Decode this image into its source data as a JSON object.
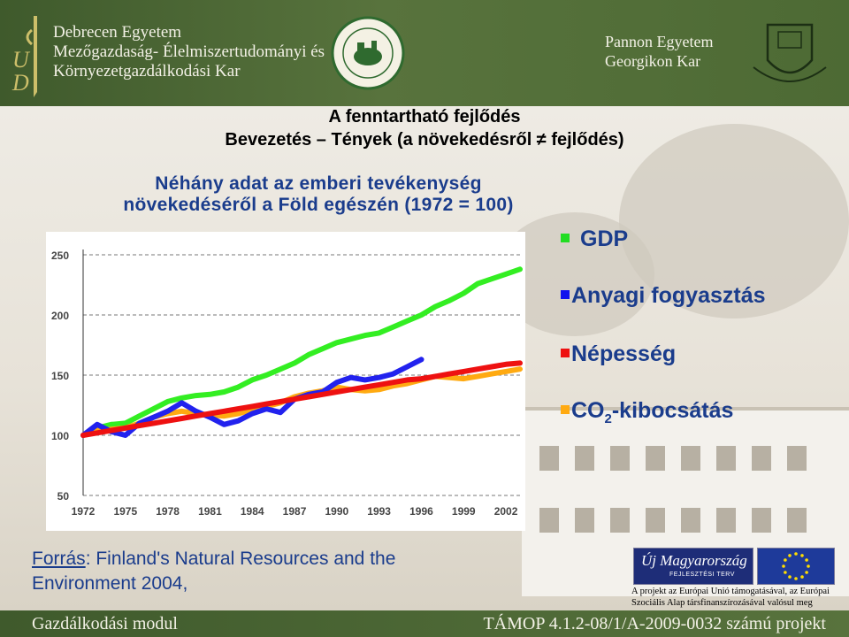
{
  "header": {
    "left_lines": [
      "Debrecen Egyetem",
      "Mezőgazdaság- Élelmiszertudományi és",
      "Környezetgazdálkodási Kar"
    ],
    "right_lines": [
      "Pannon Egyetem",
      "Georgikon Kar"
    ]
  },
  "slide": {
    "title": "A fenntartható fejlődés",
    "subtitle": "Bevezetés – Tények (a növekedésről ≠ fejlődés)",
    "chart_heading_lines": [
      "Néhány adat az emberi tevékenység",
      "növekedéséről a Föld egészén (1972 = 100)"
    ]
  },
  "chart_data": {
    "type": "line",
    "x": [
      1972,
      1973,
      1974,
      1975,
      1976,
      1977,
      1978,
      1979,
      1980,
      1981,
      1982,
      1983,
      1984,
      1985,
      1986,
      1987,
      1988,
      1989,
      1990,
      1991,
      1992,
      1993,
      1994,
      1995,
      1996,
      1997,
      1998,
      1999,
      2000,
      2001,
      2002,
      2003
    ],
    "xticks": [
      1972,
      1975,
      1978,
      1981,
      1984,
      1987,
      1990,
      1993,
      1996,
      1999,
      2002
    ],
    "yticks": [
      50,
      100,
      150,
      200,
      250
    ],
    "ylim": [
      50,
      250
    ],
    "xlim": [
      1972,
      2003
    ],
    "grid": "dashed horizontal",
    "series": [
      {
        "name": "GDP",
        "color": "#33ee22",
        "values": [
          100,
          106,
          109,
          110,
          116,
          122,
          128,
          131,
          133,
          134,
          136,
          140,
          146,
          150,
          155,
          160,
          167,
          172,
          177,
          180,
          183,
          185,
          190,
          195,
          200,
          207,
          212,
          218,
          226,
          230,
          234,
          238
        ]
      },
      {
        "name": "Anyagi fogyasztás",
        "color": "#2222ee",
        "values": [
          100,
          109,
          103,
          100,
          110,
          115,
          120,
          127,
          120,
          115,
          109,
          112,
          118,
          122,
          119,
          130,
          134,
          136,
          144,
          148,
          146,
          148,
          151,
          157,
          163
        ]
      },
      {
        "name": "Népesség",
        "color": "#ee1111",
        "values": [
          100,
          102,
          104,
          106,
          108,
          110,
          112,
          114,
          116,
          118,
          120,
          122,
          124,
          126,
          128,
          130,
          132,
          134,
          136,
          138,
          140,
          142,
          144,
          146,
          147,
          149,
          151,
          153,
          155,
          157,
          159,
          160
        ]
      },
      {
        "name": "CO₂-kibocsátás",
        "color": "#ffaa11",
        "values": [
          100,
          104,
          105,
          106,
          110,
          115,
          118,
          120,
          118,
          117,
          116,
          118,
          121,
          124,
          127,
          132,
          135,
          137,
          140,
          138,
          137,
          138,
          141,
          143,
          146,
          149,
          148,
          147,
          149,
          151,
          153,
          155
        ]
      }
    ]
  },
  "legend": [
    {
      "label": "GDP",
      "color": "#22dd22"
    },
    {
      "label": "Anyagi fogyasztás",
      "color": "#1111ee"
    },
    {
      "label": "Népesség",
      "color": "#ee1111"
    },
    {
      "label_main": "CO",
      "label_sub": "2",
      "label_rest": "-kibocsátás",
      "color": "#ffaa11"
    }
  ],
  "source": {
    "link_text": "Forrás",
    "rest": ": Finland's Natural Resources and the",
    "line2": "Environment 2004,"
  },
  "footer_logos": {
    "uj_magyarorszag": "Új Magyarország",
    "fejlesztesi_terv": "FEJLESZTÉSI TERV",
    "eu_lines": [
      "A projekt az Európai Unió támogatásával, az Európai",
      "Szociális Alap társfinanszírozásával valósul meg"
    ]
  },
  "footer": {
    "left": "Gazdálkodási modul",
    "right": "TÁMOP 4.1.2-08/1/A-2009-0032 számú projekt"
  }
}
